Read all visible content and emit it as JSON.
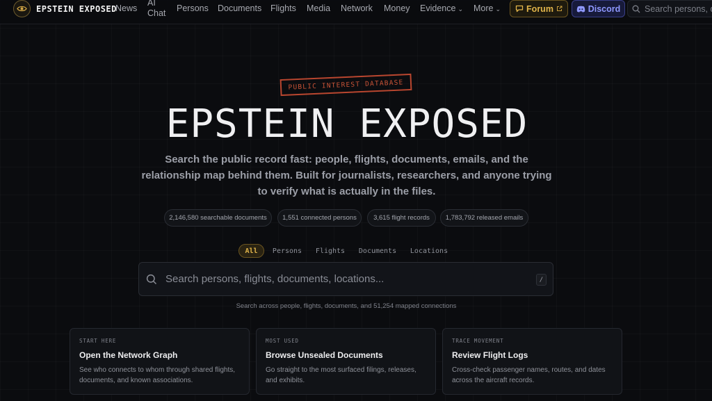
{
  "header": {
    "brand": "EPSTEIN EXPOSED",
    "logo_icon": "eye-icon",
    "nav": [
      {
        "label": "News"
      },
      {
        "label_line1": "AI",
        "label_line2": "Chat"
      },
      {
        "label": "Persons"
      },
      {
        "label": "Documents"
      },
      {
        "label": "Flights"
      },
      {
        "label": "Media"
      },
      {
        "label": "Network"
      },
      {
        "label": "Money"
      },
      {
        "label": "Evidence",
        "has_dropdown": true
      },
      {
        "label": "More",
        "has_dropdown": true
      }
    ],
    "forum": {
      "label": "Forum",
      "icon": "chat-icon",
      "trailing_icon": "external-link-icon",
      "color": "#e0b44a"
    },
    "discord": {
      "label": "Discord",
      "icon": "discord-icon",
      "color": "#8f98ff"
    },
    "search_placeholder": "Search persons, do"
  },
  "hero": {
    "stamp": "PUBLIC INTEREST DATABASE",
    "title": "EPSTEIN EXPOSED",
    "subtitle": "Search the public record fast: people, flights, documents, emails, and the relationship map behind them. Built for journalists, researchers, and anyone trying to verify what is actually in the files."
  },
  "stats": [
    "2,146,580 searchable documents",
    "1,551 connected persons",
    "3,615 flight records",
    "1,783,792 released emails"
  ],
  "search_tabs": [
    {
      "label": "All",
      "active": true
    },
    {
      "label": "Persons",
      "active": false
    },
    {
      "label": "Flights",
      "active": false
    },
    {
      "label": "Documents",
      "active": false
    },
    {
      "label": "Locations",
      "active": false
    }
  ],
  "search": {
    "placeholder": "Search persons, flights, documents, locations...",
    "shortcut": "/",
    "helper": "Search across people, flights, documents, and 51,254 mapped connections"
  },
  "cards": [
    {
      "kicker": "START HERE",
      "title": "Open the Network Graph",
      "desc": "See who connects to whom through shared flights, documents, and known associations."
    },
    {
      "kicker": "MOST USED",
      "title": "Browse Unsealed Documents",
      "desc": "Go straight to the most surfaced filings, releases, and exhibits."
    },
    {
      "kicker": "TRACE MOVEMENT",
      "title": "Review Flight Logs",
      "desc": "Cross-check passenger names, routes, and dates across the aircraft records."
    }
  ],
  "colors": {
    "accent": "#e0b44a",
    "stamp": "#c65236",
    "background": "#0b0c0f"
  }
}
